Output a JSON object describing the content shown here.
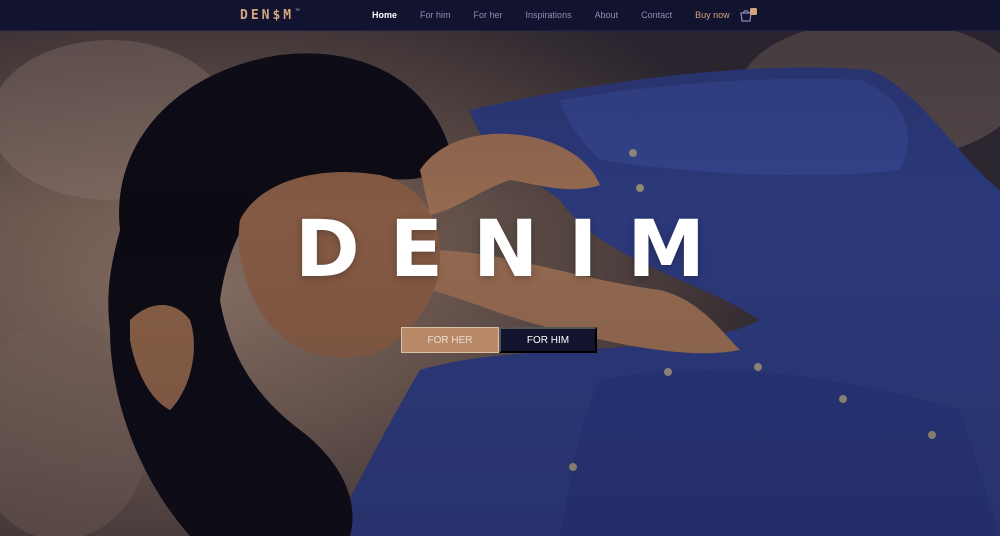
{
  "nav": {
    "logo": "DEN$M",
    "logo_mark": "™",
    "links": [
      {
        "label": "Home",
        "active": true
      },
      {
        "label": "For him"
      },
      {
        "label": "For her"
      },
      {
        "label": "Inspirations"
      },
      {
        "label": "About"
      },
      {
        "label": "Contact"
      },
      {
        "label": "Buy now"
      }
    ],
    "cart_icon": "shopping-bag-icon"
  },
  "hero": {
    "headline": "DENIM",
    "buttons": {
      "for_her": "For her",
      "for_him": "For him"
    }
  },
  "colors": {
    "navbar": "#12132e",
    "accent": "#d2a57e",
    "button_her": "#b98a67",
    "button_him": "#13132f",
    "denim": "#2f3f86"
  }
}
